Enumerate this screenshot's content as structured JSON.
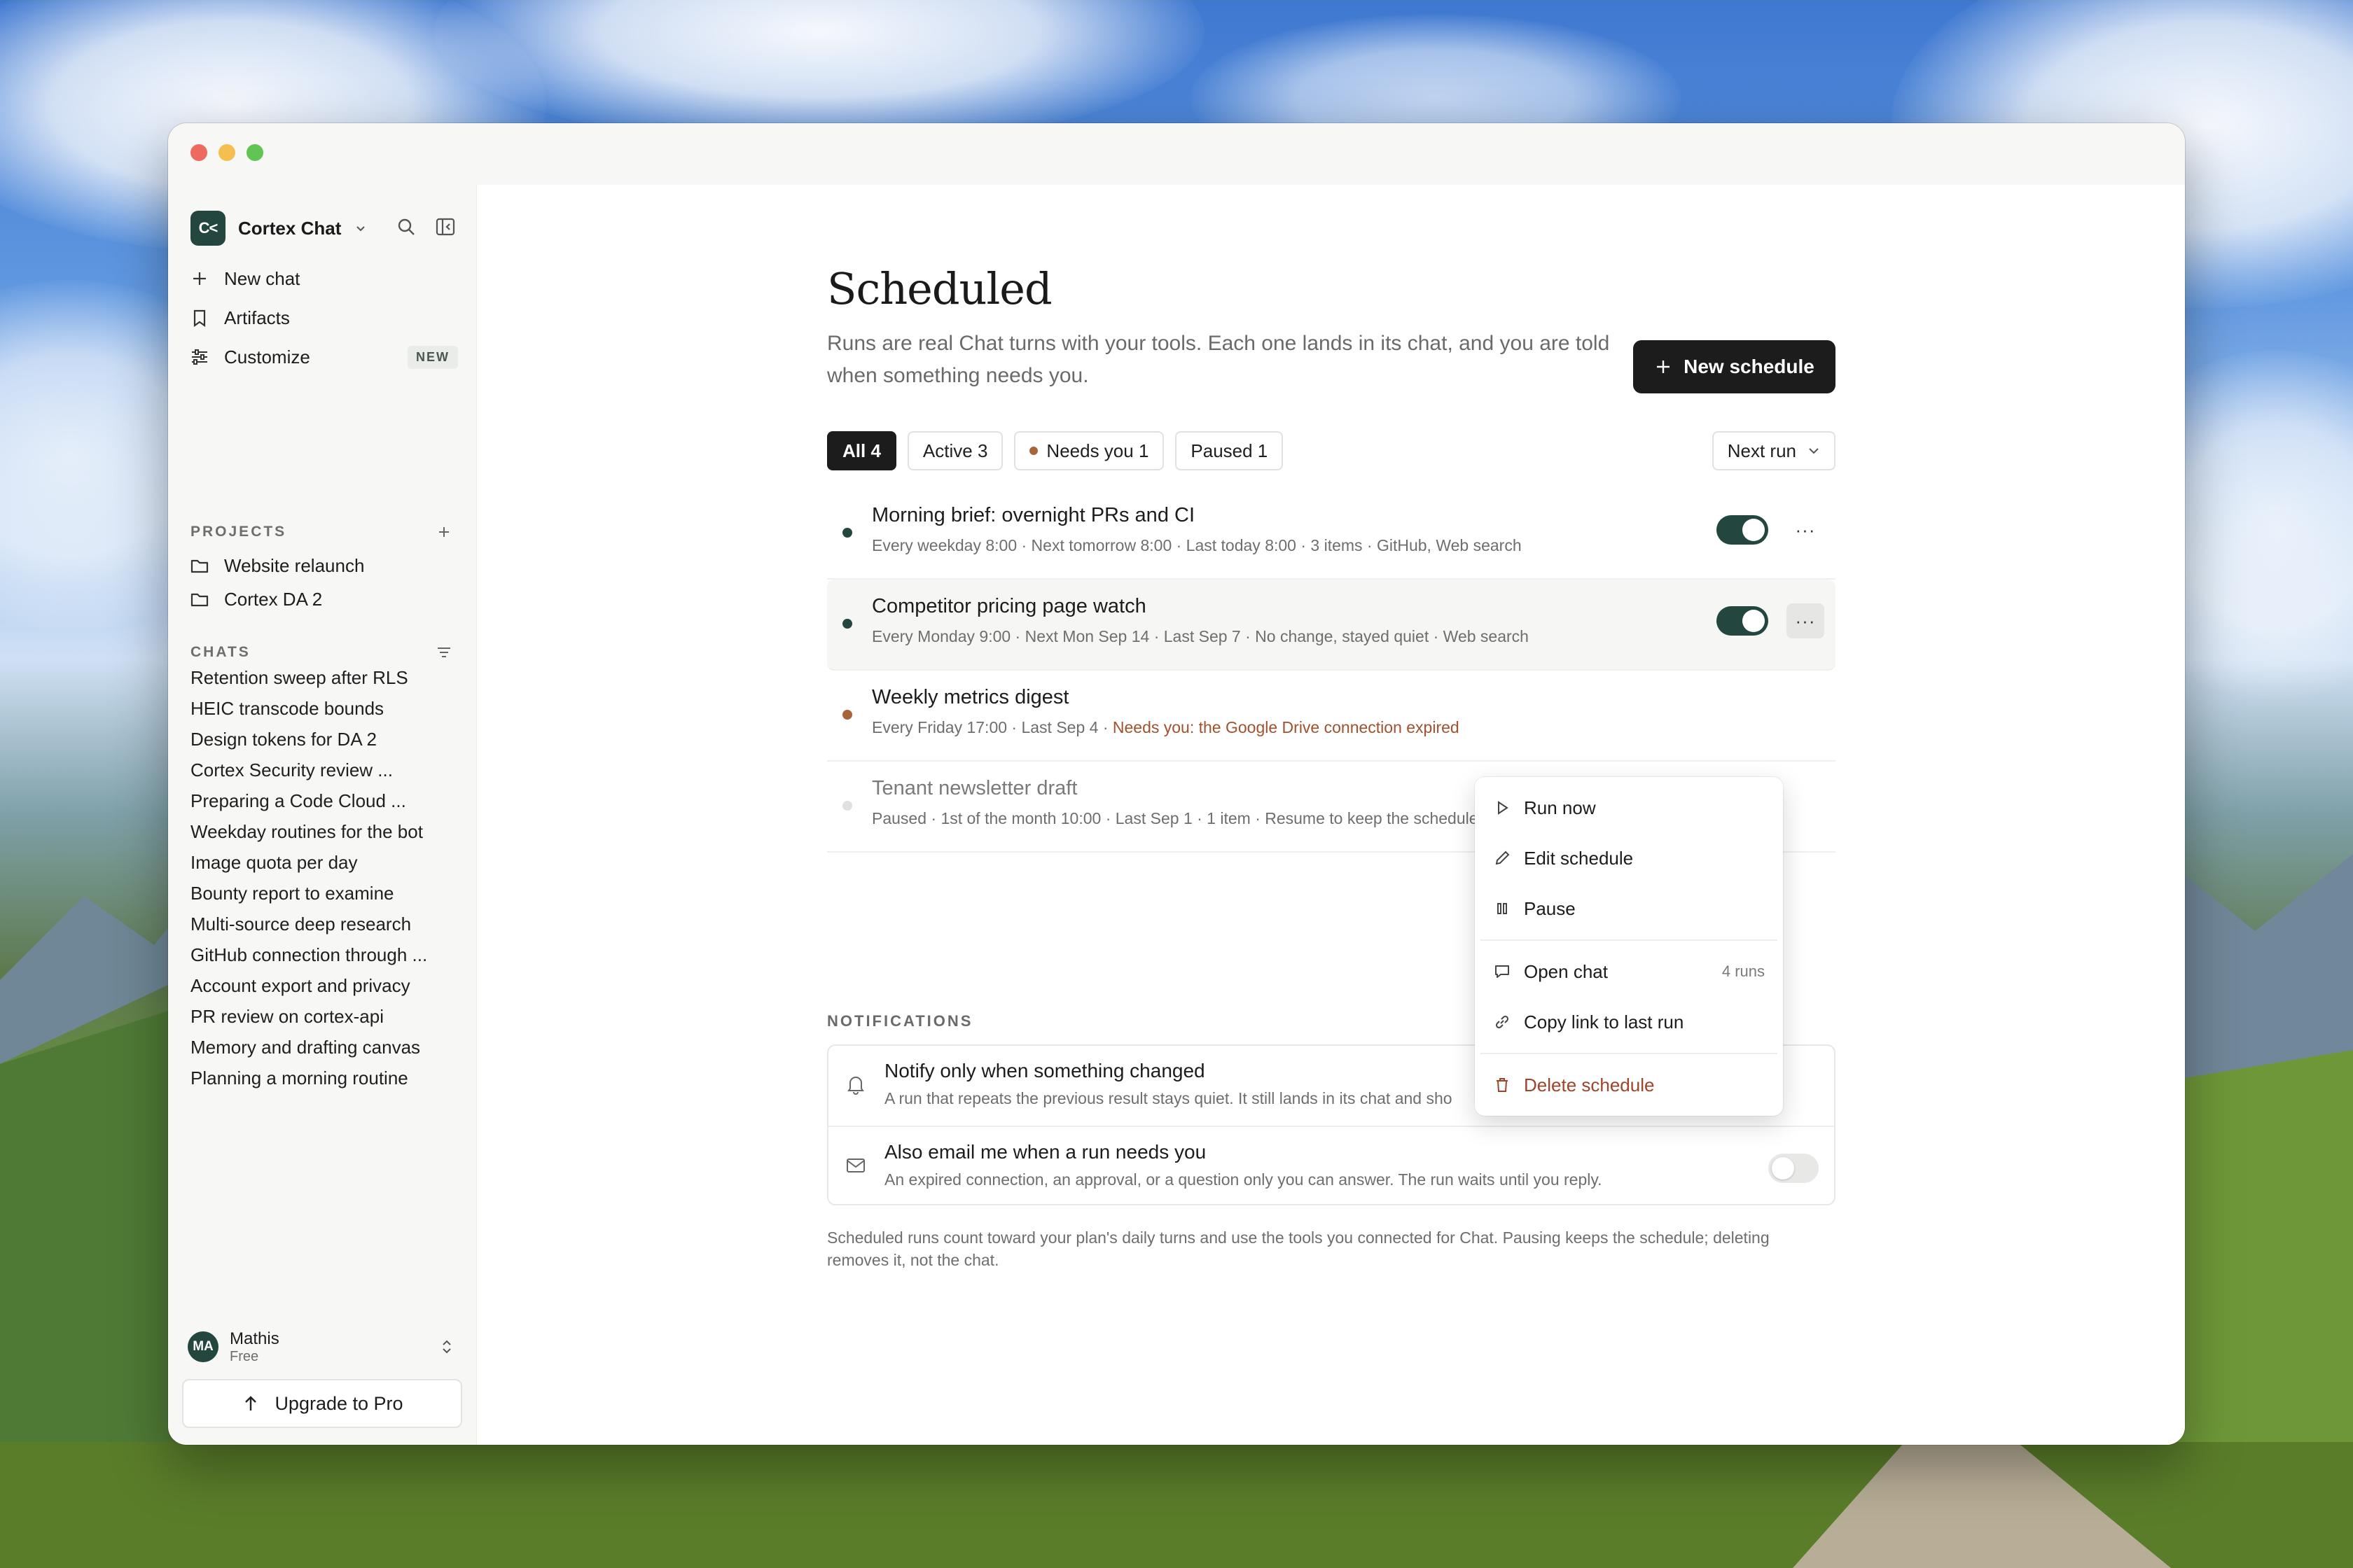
{
  "sidebar": {
    "workspace_logo": "C<",
    "workspace_name": "Cortex Chat",
    "nav": [
      {
        "label": "New chat",
        "icon": "plus-icon"
      },
      {
        "label": "Artifacts",
        "icon": "bookmark-icon"
      },
      {
        "label": "Customize",
        "icon": "sliders-icon",
        "badge": "NEW"
      }
    ],
    "projects_label": "PROJECTS",
    "projects": [
      "Website relaunch",
      "Cortex DA 2"
    ],
    "chats_label": "CHATS",
    "chats": [
      "Retention sweep after RLS",
      "HEIC transcode bounds",
      "Design tokens for DA 2",
      "Cortex Security review ...",
      "Preparing a Code Cloud ...",
      "Weekday routines for the bot",
      "Image quota per day",
      "Bounty report to examine",
      "Multi-source deep research",
      "GitHub connection through ...",
      "Account export and privacy",
      "PR review on cortex-api",
      "Memory and drafting canvas",
      "Planning a morning routine"
    ],
    "user": {
      "initials": "MA",
      "name": "Mathis",
      "plan": "Free"
    },
    "upgrade_label": "Upgrade to Pro"
  },
  "main": {
    "title": "Scheduled",
    "subtitle": "Runs are real Chat turns with your tools. Each one lands in its chat, and you are told when something needs you.",
    "new_button": "New schedule",
    "filters": [
      {
        "label": "All 4",
        "active": true
      },
      {
        "label": "Active 3",
        "active": false
      },
      {
        "label": "Needs you 1",
        "active": false,
        "dot": true
      },
      {
        "label": "Paused 1",
        "active": false
      }
    ],
    "sort_label": "Next run",
    "schedules": [
      {
        "title": "Morning brief: overnight PRs and CI",
        "meta": "Every weekday 8:00 · Next tomorrow 8:00 · Last today 8:00 · 3 items · GitHub, Web search",
        "status": "active",
        "enabled": true
      },
      {
        "title": "Competitor pricing page watch",
        "meta": "Every Monday 9:00 · Next Mon Sep 14 · Last Sep 7 · No change, stayed quiet · Web search",
        "status": "active",
        "enabled": true
      },
      {
        "title": "Weekly metrics digest",
        "meta": "Every Friday 17:00 · Last Sep 4 · ",
        "warning": "Needs you: the Google Drive connection expired",
        "status": "needs-you"
      },
      {
        "title": "Tenant newsletter draft",
        "meta": "Paused · 1st of the month 10:00 · Last Sep 1 · 1 item · Resume to keep the schedule",
        "status": "paused"
      }
    ],
    "notifications_label": "NOTIFICATIONS",
    "notifications": [
      {
        "title": "Notify only when something changed",
        "desc": "A run that repeats the previous result stays quiet. It still lands in its chat and sho"
      },
      {
        "title": "Also email me when a run needs you",
        "desc": "An expired connection, an approval, or a question only you can answer. The run waits until you reply.",
        "enabled": false
      }
    ],
    "footer": "Scheduled runs count toward your plan's daily turns and use the tools you connected for Chat. Pausing keeps the schedule; deleting removes it, not the chat."
  },
  "menu": {
    "items": [
      {
        "label": "Run now",
        "icon": "play-icon"
      },
      {
        "label": "Edit schedule",
        "icon": "pencil-icon"
      },
      {
        "label": "Pause",
        "icon": "pause-icon"
      },
      {
        "label": "Open chat",
        "icon": "chat-bubble-icon",
        "hint": "4 runs"
      },
      {
        "label": "Copy link to last run",
        "icon": "link-icon"
      },
      {
        "label": "Delete schedule",
        "icon": "trash-icon"
      }
    ]
  },
  "colors": {
    "accent": "#23463f",
    "warning": "#a0522d",
    "danger": "#a0432b"
  }
}
